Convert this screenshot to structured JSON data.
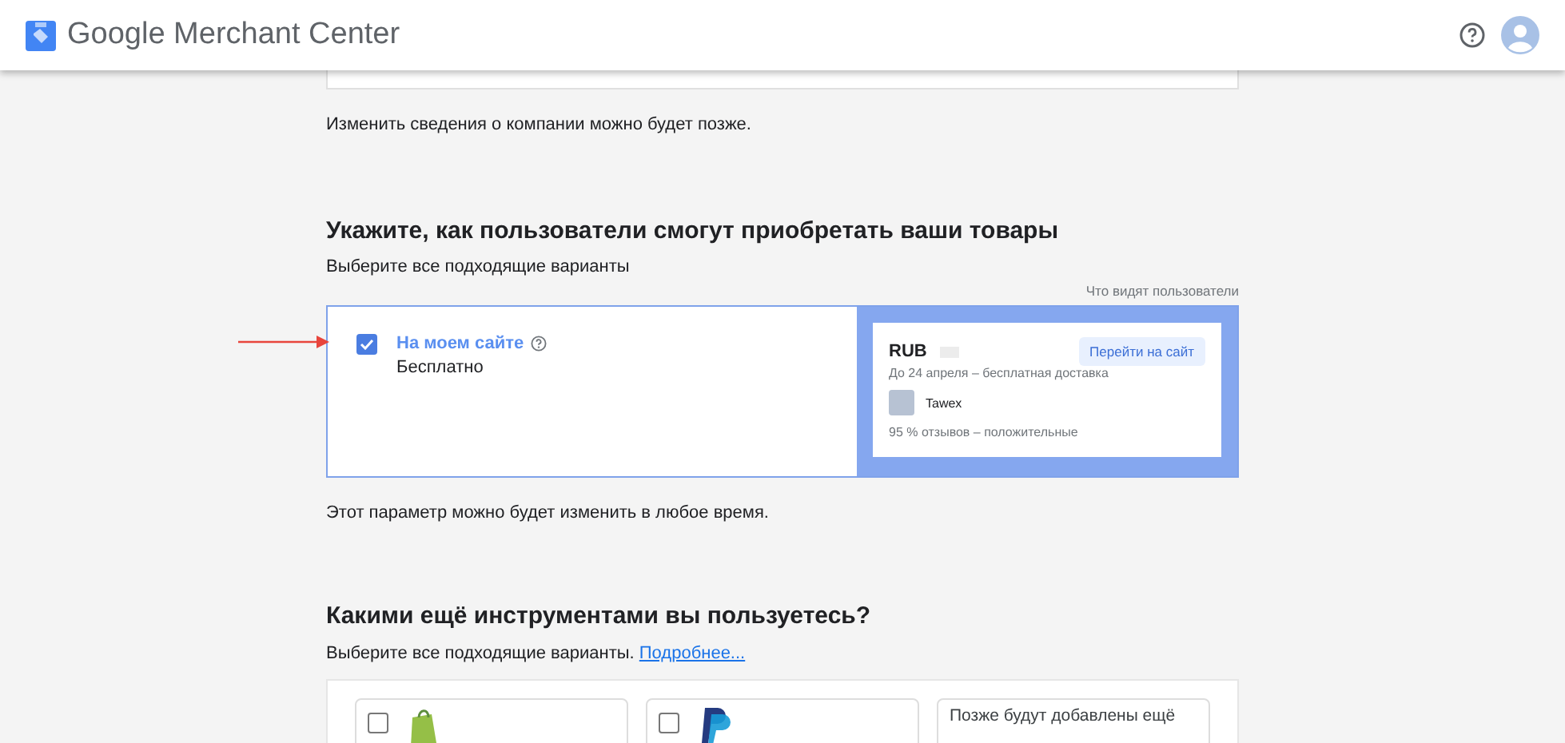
{
  "header": {
    "title": "Google Merchant Center"
  },
  "company_note": "Изменить сведения о компании можно будет позже.",
  "purchase": {
    "heading": "Укажите, как пользователи смогут приобретать ваши товары",
    "subtitle": "Выберите все подходящие варианты",
    "preview_label": "Что видят пользователи",
    "options": [
      {
        "label": "На моем сайте",
        "price": "Бесплатно",
        "checked": true
      }
    ],
    "preview": {
      "currency": "RUB",
      "button": "Перейти на сайт",
      "delivery": "До 24 апреля – бесплатная доставка",
      "store": "Tawex",
      "reviews": "95 % отзывов – положительные"
    },
    "note": "Этот параметр можно будет изменить в любое время."
  },
  "tools": {
    "heading": "Какими ещё инструментами вы пользуетесь?",
    "subtitle": "Выберите все подходящие варианты.",
    "link": "Подробнее...",
    "items": [
      {
        "kind": "shopify",
        "checked": false
      },
      {
        "kind": "paypal",
        "checked": false
      },
      {
        "kind": "more",
        "text": "Позже будут добавлены ещё"
      }
    ]
  }
}
